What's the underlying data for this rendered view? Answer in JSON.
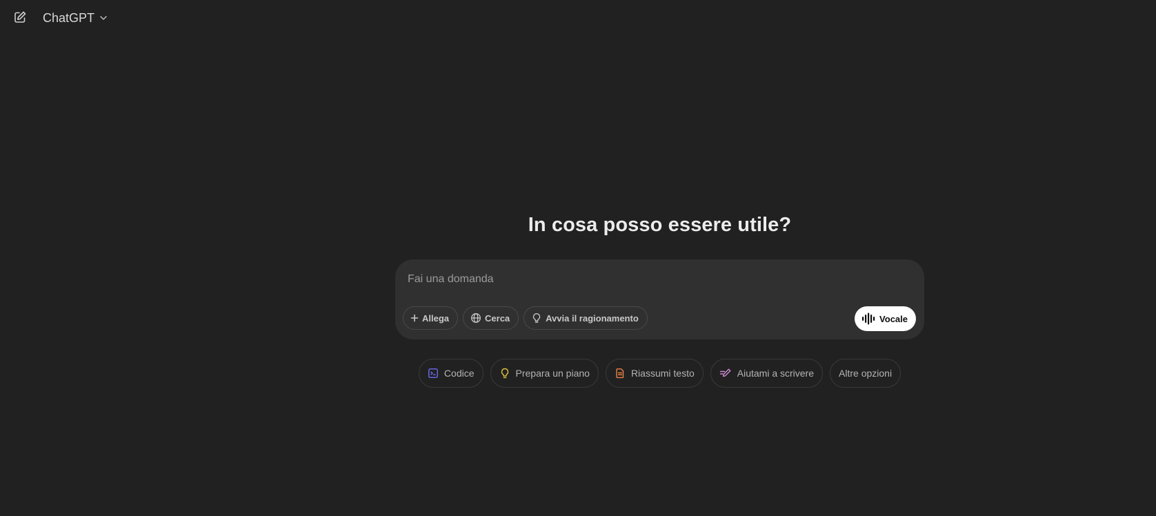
{
  "header": {
    "app_title": "ChatGPT",
    "new_chat_icon": "edit-icon",
    "switcher_icon": "chevron-down-icon"
  },
  "main": {
    "headline": "In cosa posso essere utile?"
  },
  "composer": {
    "placeholder": "Fai una domanda",
    "value": "",
    "tools": [
      {
        "label": "Allega",
        "icon": "plus-icon"
      },
      {
        "label": "Cerca",
        "icon": "globe-icon"
      },
      {
        "label": "Avvia il ragionamento",
        "icon": "lightbulb-icon"
      }
    ],
    "voice": {
      "label": "Vocale",
      "icon": "voice-waveform-icon"
    }
  },
  "suggestions": [
    {
      "label": "Codice",
      "icon": "code-icon",
      "color": "#6b6bf5"
    },
    {
      "label": "Prepara un piano",
      "icon": "lightbulb-icon",
      "color": "#e2c541"
    },
    {
      "label": "Riassumi testo",
      "icon": "document-icon",
      "color": "#ea8444"
    },
    {
      "label": "Aiutami a scrivere",
      "icon": "pen-icon",
      "color": "#cb8bd0"
    },
    {
      "label": "Altre opzioni",
      "icon": "",
      "color": ""
    }
  ],
  "theme": {
    "background": "#212121",
    "composer_background": "#303030",
    "text": "#ececec"
  }
}
